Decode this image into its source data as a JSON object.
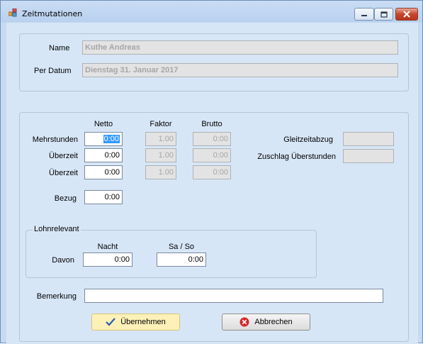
{
  "window": {
    "title": "Zeitmutationen",
    "title_icon": "app-icon",
    "controls": {
      "minimize": "minimize-icon",
      "maximize": "maximize-icon",
      "close": "close-icon"
    }
  },
  "header_group": {
    "name_label": "Name",
    "name_value": "Kuthe Andreas",
    "date_label": "Per Datum",
    "date_value": "Dienstag 31. Januar 2017"
  },
  "columns": {
    "netto": "Netto",
    "faktor": "Faktor",
    "brutto": "Brutto"
  },
  "rows": [
    {
      "label": "Mehrstunden",
      "netto": "0:00",
      "faktor": "1.00",
      "brutto": "0:00"
    },
    {
      "label": "Überzeit",
      "netto": "0:00",
      "faktor": "1.00",
      "brutto": "0:00"
    },
    {
      "label": "Überzeit",
      "netto": "0:00",
      "faktor": "1.00",
      "brutto": "0:00"
    }
  ],
  "bezug": {
    "label": "Bezug",
    "value": "0:00"
  },
  "right_fields": {
    "gleitzeitabzug_label": "Gleitzeitabzug",
    "gleitzeitabzug_value": "",
    "zuschlag_label": "Zuschlag Überstunden",
    "zuschlag_value": ""
  },
  "lohnrelevant": {
    "title": "Lohnrelevant",
    "davon_label": "Davon",
    "nacht_label": "Nacht",
    "nacht_value": "0:00",
    "saso_label": "Sa / So",
    "saso_value": "0:00"
  },
  "bemerkung": {
    "label": "Bemerkung",
    "value": ""
  },
  "buttons": {
    "ok_label": "Übernehmen",
    "ok_icon": "checkmark-icon",
    "cancel_label": "Abbrechen",
    "cancel_icon": "cancel-x-icon"
  },
  "colors": {
    "client_bg": "#d7e6f7",
    "ok_bg": "#fdf1b8",
    "selection": "#3399ff",
    "close_red": "#c8452b"
  }
}
